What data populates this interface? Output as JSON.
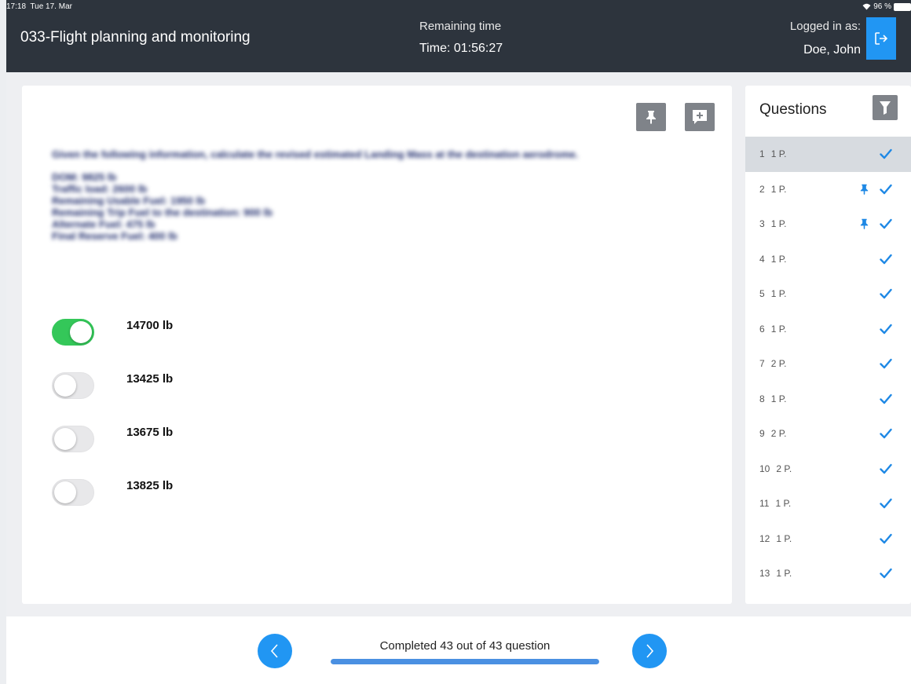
{
  "status_bar": {
    "time": "17:18",
    "date": "Tue 17. Mar",
    "battery": "96 %"
  },
  "header": {
    "app_title": "033-Flight planning and monitoring",
    "timer_label": "Remaining time",
    "timer_value": "Time: 01:56:27",
    "login_label": "Logged in as:",
    "user_name": "Doe, John"
  },
  "icons": {
    "logout": "logout-icon",
    "pin": "pin-icon",
    "add_note": "add-note-icon",
    "filter": "filter-icon",
    "check": "check-icon",
    "prev": "chevron-left-icon",
    "next": "chevron-right-icon"
  },
  "question": {
    "text_lines": [
      "Given the following information, calculate the revised estimated Landing Mass at the destination aerodrome.",
      "DOM: 9825 lb",
      "Traffic load: 2600 lb",
      "Remaining Usable Fuel: 1950 lb",
      "Remaining Trip Fuel to the destination: 900 lb",
      "Alternate Fuel: 475 lb",
      "Final Reserve Fuel: 400 lb"
    ],
    "answers": [
      {
        "label": "14700 lb",
        "selected": true
      },
      {
        "label": "13425 lb",
        "selected": false
      },
      {
        "label": "13675 lb",
        "selected": false
      },
      {
        "label": "13825 lb",
        "selected": false
      }
    ]
  },
  "sidebar": {
    "title": "Questions",
    "items": [
      {
        "num": "1",
        "points": "1 P.",
        "pinned": false,
        "answered": true,
        "active": true
      },
      {
        "num": "2",
        "points": "1 P.",
        "pinned": true,
        "answered": true,
        "active": false
      },
      {
        "num": "3",
        "points": "1 P.",
        "pinned": true,
        "answered": true,
        "active": false
      },
      {
        "num": "4",
        "points": "1 P.",
        "pinned": false,
        "answered": true,
        "active": false
      },
      {
        "num": "5",
        "points": "1 P.",
        "pinned": false,
        "answered": true,
        "active": false
      },
      {
        "num": "6",
        "points": "1 P.",
        "pinned": false,
        "answered": true,
        "active": false
      },
      {
        "num": "7",
        "points": "2 P.",
        "pinned": false,
        "answered": true,
        "active": false
      },
      {
        "num": "8",
        "points": "1 P.",
        "pinned": false,
        "answered": true,
        "active": false
      },
      {
        "num": "9",
        "points": "2 P.",
        "pinned": false,
        "answered": true,
        "active": false
      },
      {
        "num": "10",
        "points": "2 P.",
        "pinned": false,
        "answered": true,
        "active": false
      },
      {
        "num": "11",
        "points": "1 P.",
        "pinned": false,
        "answered": true,
        "active": false
      },
      {
        "num": "12",
        "points": "1 P.",
        "pinned": false,
        "answered": true,
        "active": false
      },
      {
        "num": "13",
        "points": "1 P.",
        "pinned": false,
        "answered": true,
        "active": false
      }
    ]
  },
  "footer": {
    "progress_text": "Completed 43 out of 43 question",
    "progress_fraction": 1.0
  },
  "colors": {
    "header_bg": "#2d343d",
    "accent_blue": "#2196f3",
    "toggle_on": "#34c759",
    "check_blue": "#1e88e5",
    "icon_button_gray": "#7f8389"
  }
}
